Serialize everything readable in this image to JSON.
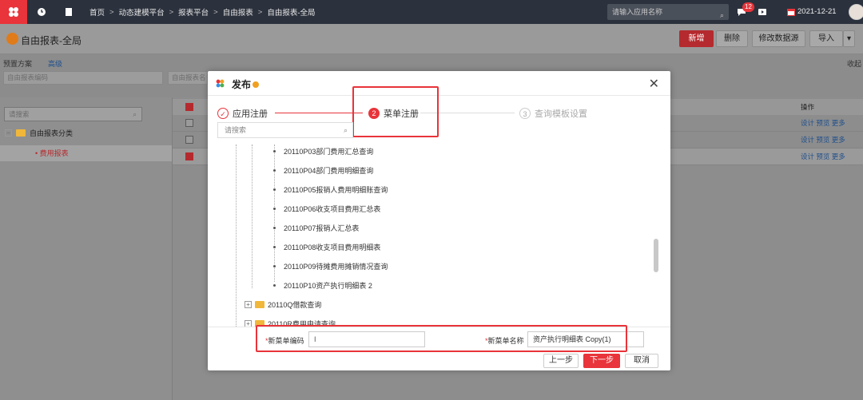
{
  "topbar": {
    "breadcrumb": [
      "首页",
      "动态建模平台",
      "报表平台",
      "自由报表",
      "自由报表-全局"
    ],
    "search_placeholder": "请输入应用名称",
    "badge": "12",
    "date": "2021-12-21"
  },
  "subbar": {
    "title": "自由报表-全局",
    "buttons": {
      "new": "新增",
      "delete": "删除",
      "modify": "修改数据源",
      "import": "导入"
    }
  },
  "filter": {
    "preset": "预置方案",
    "advanced": "高级",
    "code_placeholder": "自由报表编码",
    "name_placeholder": "自由报表名",
    "collapse": "收起"
  },
  "left": {
    "search_placeholder": "请搜索",
    "root": "自由报表分类",
    "child": "费用报表"
  },
  "grid": {
    "ops_header": "操作",
    "ops": [
      "设计",
      "预览",
      "更多"
    ]
  },
  "modal": {
    "title": "发布",
    "steps": [
      {
        "num": "",
        "label": "应用注册"
      },
      {
        "num": "2",
        "label": "菜单注册"
      },
      {
        "num": "3",
        "label": "查询模板设置"
      }
    ],
    "search_placeholder": "请搜索",
    "items": [
      "20110P03部门费用汇总查询",
      "20110P04部门费用明细查询",
      "20110P05报销人费用明细账查询",
      "20110P06收支项目费用汇总表",
      "20110P07报销人汇总表",
      "20110P08收支项目费用明细表",
      "20110P09待摊费用摊销情况查询",
      "20110P10资产执行明细表 2"
    ],
    "folders": [
      "20110Q借款查询",
      "20110R费用申请查询"
    ],
    "code_label": "新菜单编码",
    "name_label": "新菜单名称",
    "name_value": "资产执行明细表 Copy(1)",
    "prev": "上一步",
    "next": "下一步",
    "cancel": "取消"
  }
}
